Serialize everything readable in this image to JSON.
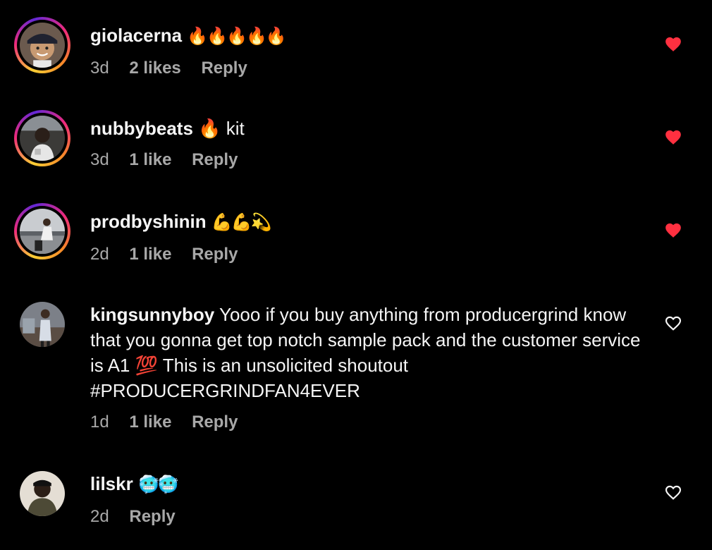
{
  "comments": [
    {
      "username": "giolacerna",
      "text": "🔥🔥🔥🔥🔥",
      "age": "3d",
      "likes": "2 likes",
      "reply": "Reply",
      "liked": true
    },
    {
      "username": "nubbybeats",
      "text": "🔥 kit",
      "age": "3d",
      "likes": "1 like",
      "reply": "Reply",
      "liked": true
    },
    {
      "username": "prodbyshinin",
      "text": "💪💪💫",
      "age": "2d",
      "likes": "1 like",
      "reply": "Reply",
      "liked": true
    },
    {
      "username": "kingsunnyboy",
      "text": "Yooo if you buy anything from producergrind know that you gonna get top notch sample pack and the customer service is A1 💯 This is an unsolicited shoutout #PRODUCERGRINDFAN4EVER",
      "age": "1d",
      "likes": "1 like",
      "reply": "Reply",
      "liked": false
    },
    {
      "username": "lilskr",
      "text": "🥶🥶",
      "age": "2d",
      "likes": "",
      "reply": "Reply",
      "liked": false
    }
  ],
  "colors": {
    "background": "#000000",
    "text": "#f5f5f5",
    "meta": "#a8a8a8",
    "heart_liked": "#ff3040",
    "heart_outline": "#f5f5f5"
  },
  "icons": {
    "liked": "heart-filled-icon",
    "unliked": "heart-outline-icon"
  }
}
